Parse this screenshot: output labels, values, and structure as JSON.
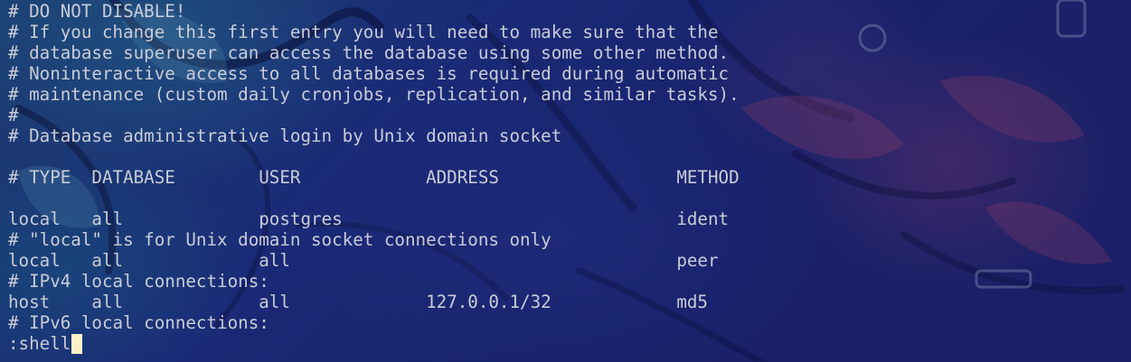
{
  "theme": {
    "text_color": "#c9ccd8",
    "cursor_color": "#fff1c6",
    "background_base": "#1d2a72"
  },
  "buffer": {
    "lines": [
      "# DO NOT DISABLE!",
      "# If you change this first entry you will need to make sure that the",
      "# database superuser can access the database using some other method.",
      "# Noninteractive access to all databases is required during automatic",
      "# maintenance (custom daily cronjobs, replication, and similar tasks).",
      "#",
      "# Database administrative login by Unix domain socket",
      "",
      "# TYPE  DATABASE        USER            ADDRESS                 METHOD",
      "",
      "local   all             postgres                                ident",
      "# \"local\" is for Unix domain socket connections only",
      "local   all             all                                     peer",
      "# IPv4 local connections:",
      "host    all             all             127.0.0.1/32            md5",
      "# IPv6 local connections:"
    ]
  },
  "command_line": {
    "text": ":shell"
  }
}
